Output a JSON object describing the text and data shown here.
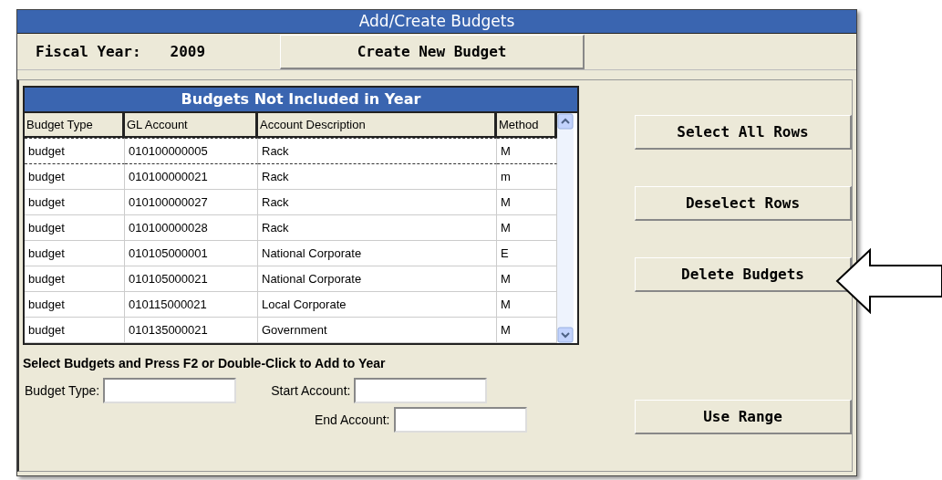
{
  "window": {
    "title": "Add/Create Budgets"
  },
  "fiscal_year": {
    "label": "Fiscal Year:",
    "value": "2009"
  },
  "create_button": "Create New Budget",
  "table": {
    "title": "Budgets Not Included in Year",
    "columns": [
      "Budget Type",
      "GL Account",
      "Account Description",
      "Method"
    ],
    "rows": [
      {
        "cells": [
          "budget",
          "010100000005",
          "Rack",
          "M"
        ],
        "focused": true
      },
      {
        "cells": [
          "budget",
          "010100000021",
          "Rack",
          "m"
        ],
        "focused": false
      },
      {
        "cells": [
          "budget",
          "010100000027",
          "Rack",
          "M"
        ],
        "focused": false
      },
      {
        "cells": [
          "budget",
          "010100000028",
          "Rack",
          "M"
        ],
        "focused": false
      },
      {
        "cells": [
          "budget",
          "010105000001",
          "National Corporate",
          "E"
        ],
        "focused": false
      },
      {
        "cells": [
          "budget",
          "010105000021",
          "National Corporate",
          "M"
        ],
        "focused": false
      },
      {
        "cells": [
          "budget",
          "010115000021",
          "Local Corporate",
          "M"
        ],
        "focused": false
      },
      {
        "cells": [
          "budget",
          "010135000021",
          "Government",
          "M"
        ],
        "focused": false
      }
    ]
  },
  "instruction": "Select Budgets and Press F2 or Double-Click to Add to Year",
  "fields": [
    {
      "label": "Budget Type:"
    },
    {
      "label": "Start Account:"
    },
    {
      "label": "End Account:"
    }
  ],
  "buttons": [
    "Select All Rows",
    "Deselect Rows",
    "Delete Budgets",
    "Use Range"
  ]
}
